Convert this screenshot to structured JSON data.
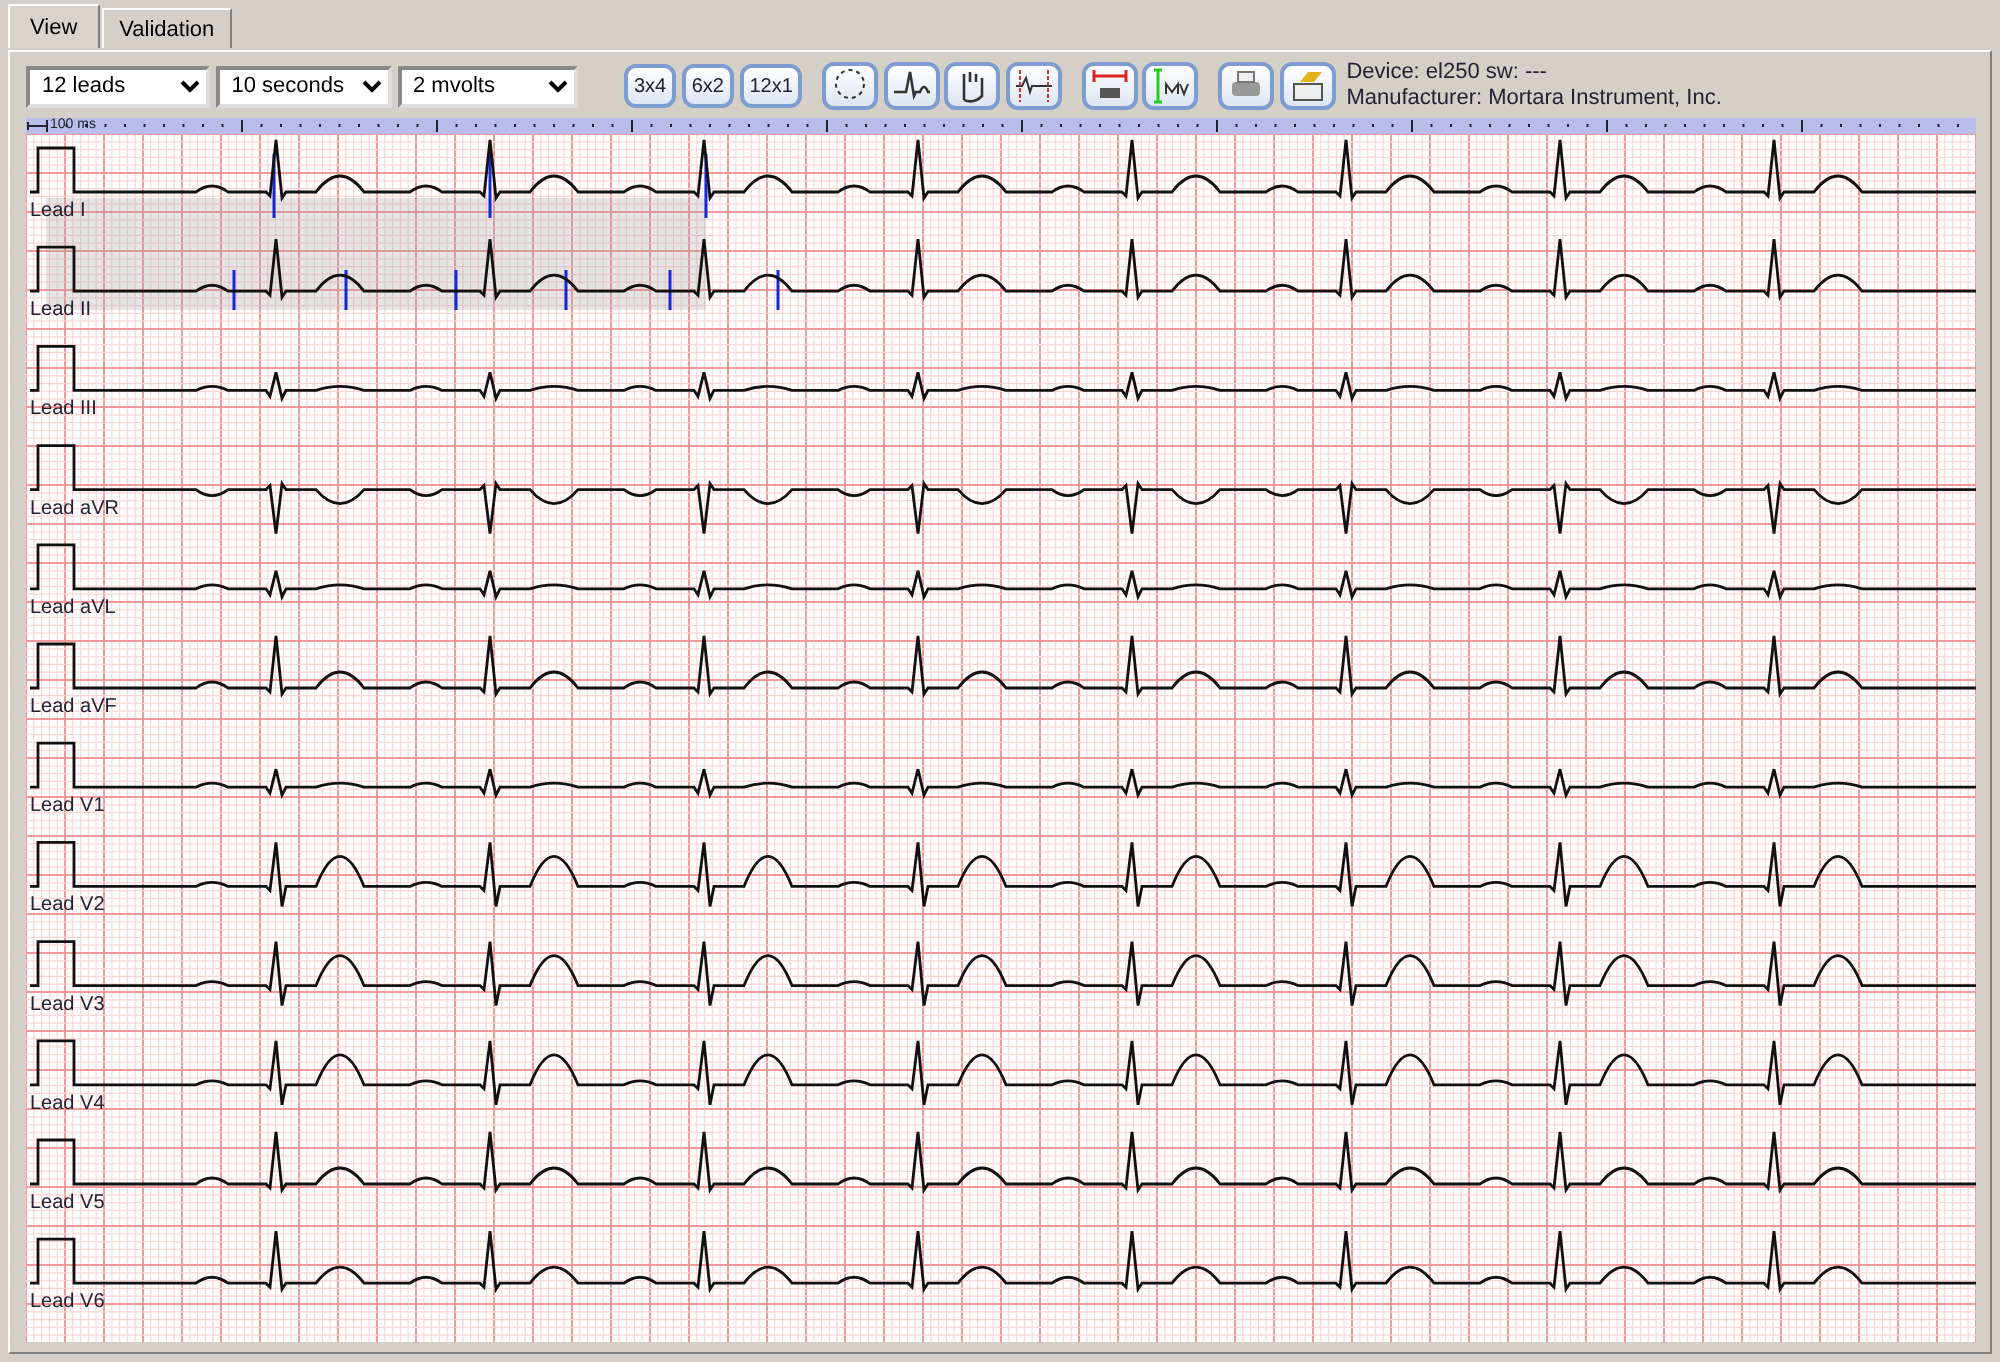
{
  "tabs": [
    {
      "label": "View",
      "selected": true
    },
    {
      "label": "Validation",
      "selected": false
    }
  ],
  "toolbar": {
    "selects": [
      {
        "value": "12 leads"
      },
      {
        "value": "10 seconds"
      },
      {
        "value": "2 mvolts"
      }
    ],
    "layout_buttons": [
      {
        "label": "3x4"
      },
      {
        "label": "6x2"
      },
      {
        "label": "12x1"
      }
    ],
    "device": "Device: el250 sw: ---",
    "manufacturer": "Manufacturer: Mortara Instrument, Inc."
  },
  "ruler": {
    "scale_label": "100 ms"
  },
  "leads": [
    {
      "label": "Lead I",
      "kind": "upright"
    },
    {
      "label": "Lead II",
      "kind": "upright"
    },
    {
      "label": "Lead III",
      "kind": "small"
    },
    {
      "label": "Lead aVR",
      "kind": "inverted"
    },
    {
      "label": "Lead aVL",
      "kind": "small"
    },
    {
      "label": "Lead aVF",
      "kind": "upright"
    },
    {
      "label": "Lead V1",
      "kind": "small"
    },
    {
      "label": "Lead V2",
      "kind": "tall-t"
    },
    {
      "label": "Lead V3",
      "kind": "tall-t"
    },
    {
      "label": "Lead V4",
      "kind": "tall-t"
    },
    {
      "label": "Lead V5",
      "kind": "upright"
    },
    {
      "label": "Lead V6",
      "kind": "upright"
    }
  ]
}
